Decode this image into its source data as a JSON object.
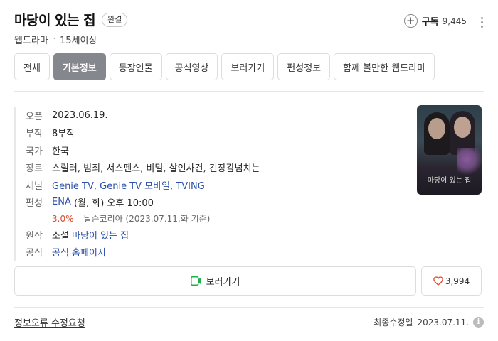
{
  "header": {
    "title": "마당이 있는 집",
    "status_badge": "완결",
    "genre_type": "웹드라마",
    "age_rating": "15세이상",
    "subscribe_label": "구독",
    "subscribe_count": "9,445"
  },
  "tabs": [
    {
      "label": "전체",
      "active": false
    },
    {
      "label": "기본정보",
      "active": true
    },
    {
      "label": "등장인물",
      "active": false
    },
    {
      "label": "공식영상",
      "active": false
    },
    {
      "label": "보러가기",
      "active": false
    },
    {
      "label": "편성정보",
      "active": false
    },
    {
      "label": "함께 볼만한 웹드라마",
      "active": false
    }
  ],
  "info": {
    "open": {
      "key": "오픈",
      "value": "2023.06.19."
    },
    "episodes": {
      "key": "부작",
      "value": "8부작"
    },
    "country": {
      "key": "국가",
      "value": "한국"
    },
    "genre": {
      "key": "장르",
      "value": "스릴러, 범죄, 서스펜스, 비밀, 살인사건, 긴장감넘치는"
    },
    "channel": {
      "key": "채널",
      "value": "Genie TV, Genie TV 모바일, TVING"
    },
    "schedule": {
      "key": "편성",
      "network": "ENA",
      "time": " (월, 화) 오후 10:00"
    },
    "rating": {
      "value": "3.0%",
      "source": "닐슨코리아 (2023.07.11.화 기준)"
    },
    "original": {
      "key": "원작",
      "prefix": "소설 ",
      "title": "마당이 있는 집"
    },
    "official": {
      "key": "공식",
      "value": "공식 홈페이지"
    }
  },
  "poster": {
    "title": "마당이 있는 집"
  },
  "actions": {
    "watch_label": "보러가기",
    "like_count": "3,994"
  },
  "footer": {
    "report_label": "정보오류 수정요청",
    "modified_label": "최종수정일",
    "modified_date": "2023.07.11."
  },
  "colors": {
    "accent_link": "#2b4fa8",
    "active_tab": "#85878e",
    "rating_red": "#e0452a",
    "play_green": "#19b24b",
    "heart_red": "#e0452a"
  }
}
